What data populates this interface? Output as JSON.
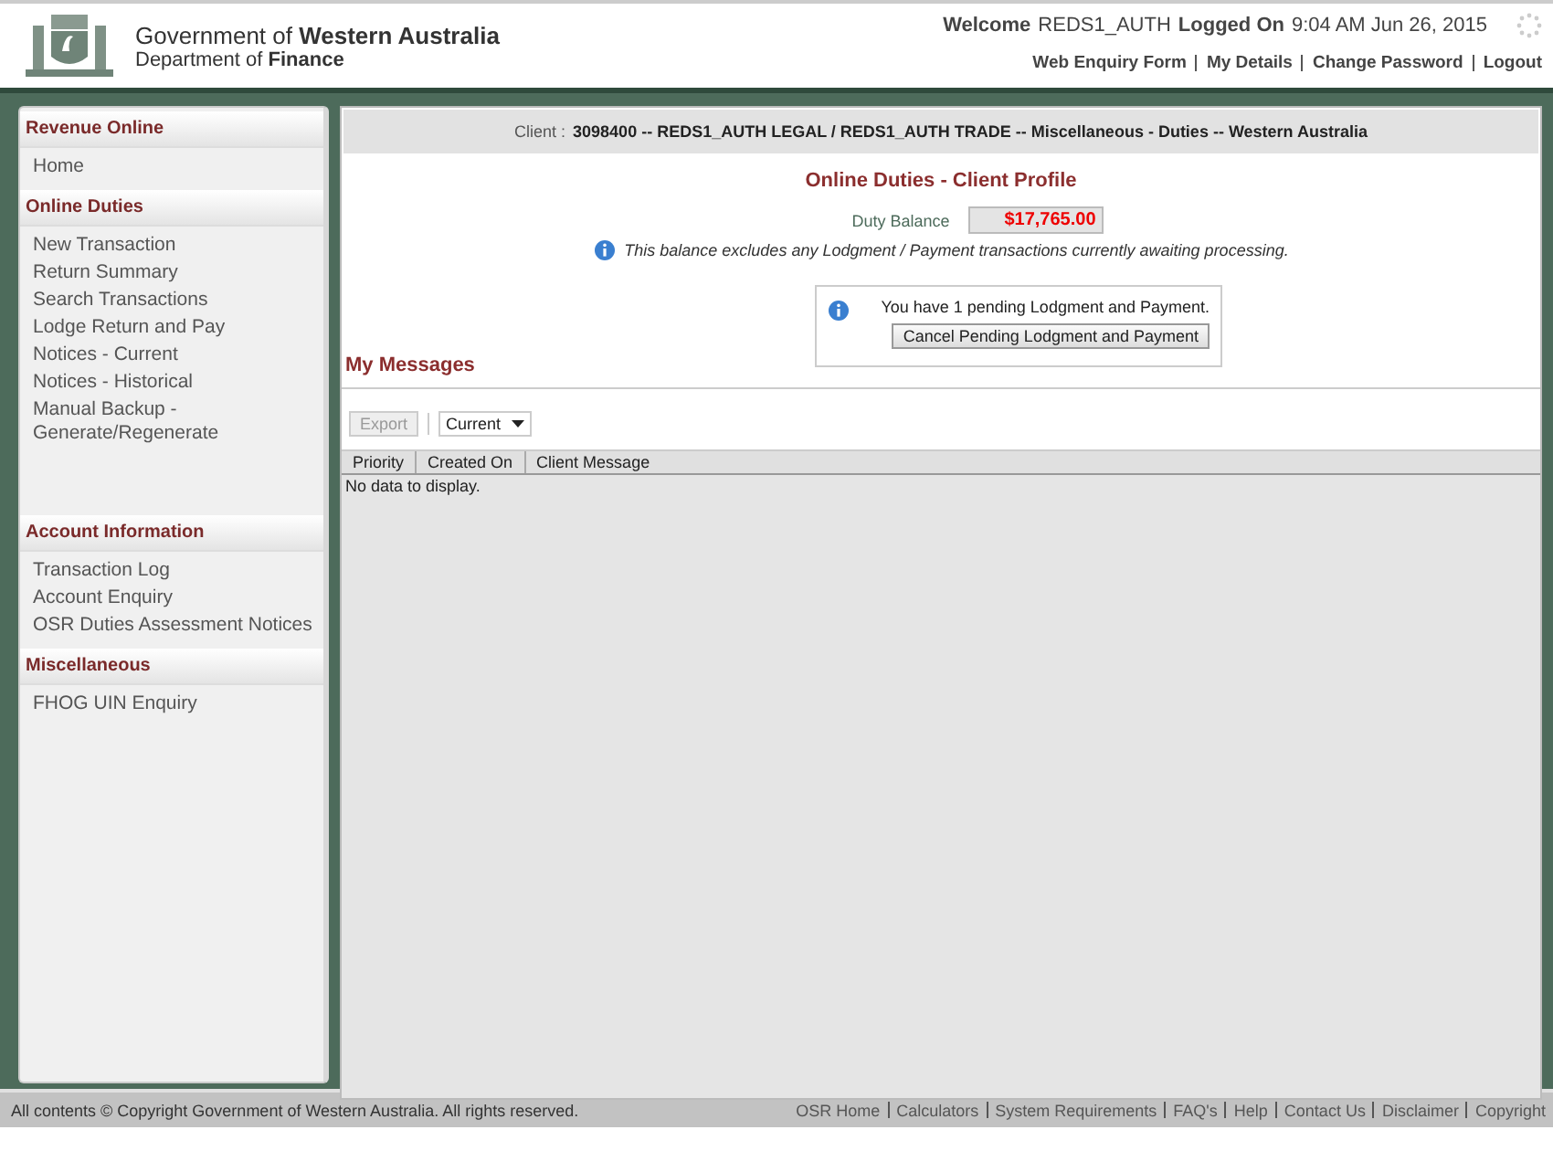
{
  "header": {
    "org_line": "Government of **Western Australia**",
    "dept_line": "Department of **Finance**",
    "welcome_label": "Welcome",
    "user": "REDS1_AUTH",
    "logged_on_label": "Logged On",
    "logged_on_time": "9:04 AM Jun 26, 2015",
    "links": [
      "Web Enquiry Form",
      "My Details",
      "Change Password",
      "Logout"
    ]
  },
  "sidebar": {
    "sections": [
      {
        "heading": "Revenue Online",
        "items": [
          "Home"
        ]
      },
      {
        "heading": "Online Duties",
        "items": [
          "New Transaction",
          "Return Summary",
          "Search Transactions",
          "Lodge Return and Pay",
          "Notices - Current",
          "Notices - Historical",
          "Manual Backup - Generate/Regenerate"
        ]
      },
      {
        "heading": "Account Information",
        "items": [
          "Transaction Log",
          "Account Enquiry",
          "OSR Duties Assessment Notices"
        ]
      },
      {
        "heading": "Miscellaneous",
        "items": [
          "FHOG UIN Enquiry"
        ]
      }
    ]
  },
  "client_bar": {
    "label": "Client :",
    "value": "3098400 -- REDS1_AUTH LEGAL / REDS1_AUTH TRADE -- Miscellaneous - Duties -- Western Australia"
  },
  "profile": {
    "title": "Online Duties - Client Profile",
    "balance_label": "Duty Balance",
    "balance_value": "$17,765.00",
    "note": "This balance excludes any Lodgment / Payment transactions currently awaiting processing.",
    "pending_text": "You have 1 pending Lodgment and Payment.",
    "pending_button": "Cancel Pending Lodgment and Payment"
  },
  "messages": {
    "title": "My Messages",
    "export_button": {
      "label": "Export",
      "disabled": true
    },
    "filter": "Current",
    "columns": [
      "Priority",
      "Created On",
      "Client Message"
    ],
    "empty_text": "No data to display."
  },
  "footer": {
    "copyright": "All contents © Copyright Government of Western Australia. All rights reserved.",
    "links": [
      "OSR Home",
      "Calculators",
      "System Requirements",
      "FAQ's",
      "Help",
      "Contact Us",
      "Disclaimer",
      "Copyright"
    ]
  }
}
